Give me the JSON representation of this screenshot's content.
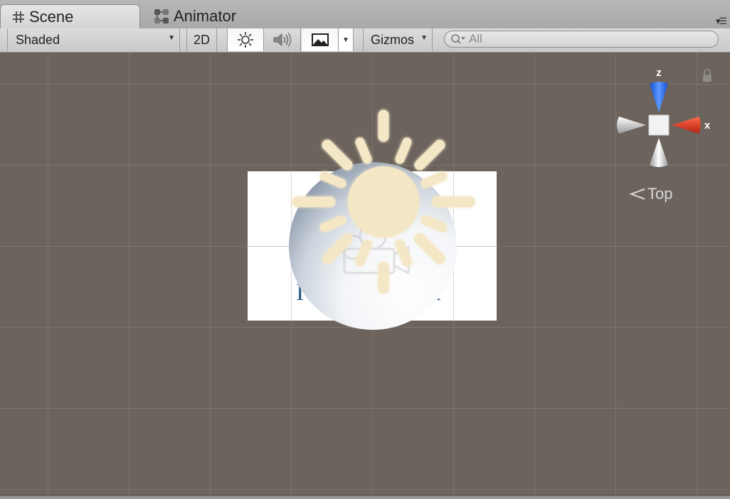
{
  "tabs": [
    {
      "label": "Scene",
      "icon": "grid-icon",
      "active": true
    },
    {
      "label": "Animator",
      "icon": "animator-icon",
      "active": false
    }
  ],
  "toolbar": {
    "draw_mode": "Shaded",
    "mode_2d": "2D",
    "lighting_icon": "sun-icon",
    "audio_icon": "speaker-icon",
    "effects_icon": "image-icon",
    "gizmos_label": "Gizmos",
    "search_placeholder": "All"
  },
  "scene": {
    "background_color": "#6b635c",
    "sprite_text_left": "I",
    "sprite_text_right": "k"
  },
  "gizmo": {
    "z_label": "z",
    "x_label": "x",
    "view_label": "Top",
    "colors": {
      "z": "#2e6bea",
      "x": "#e4412a",
      "neutral": "#e8e8e8"
    }
  }
}
